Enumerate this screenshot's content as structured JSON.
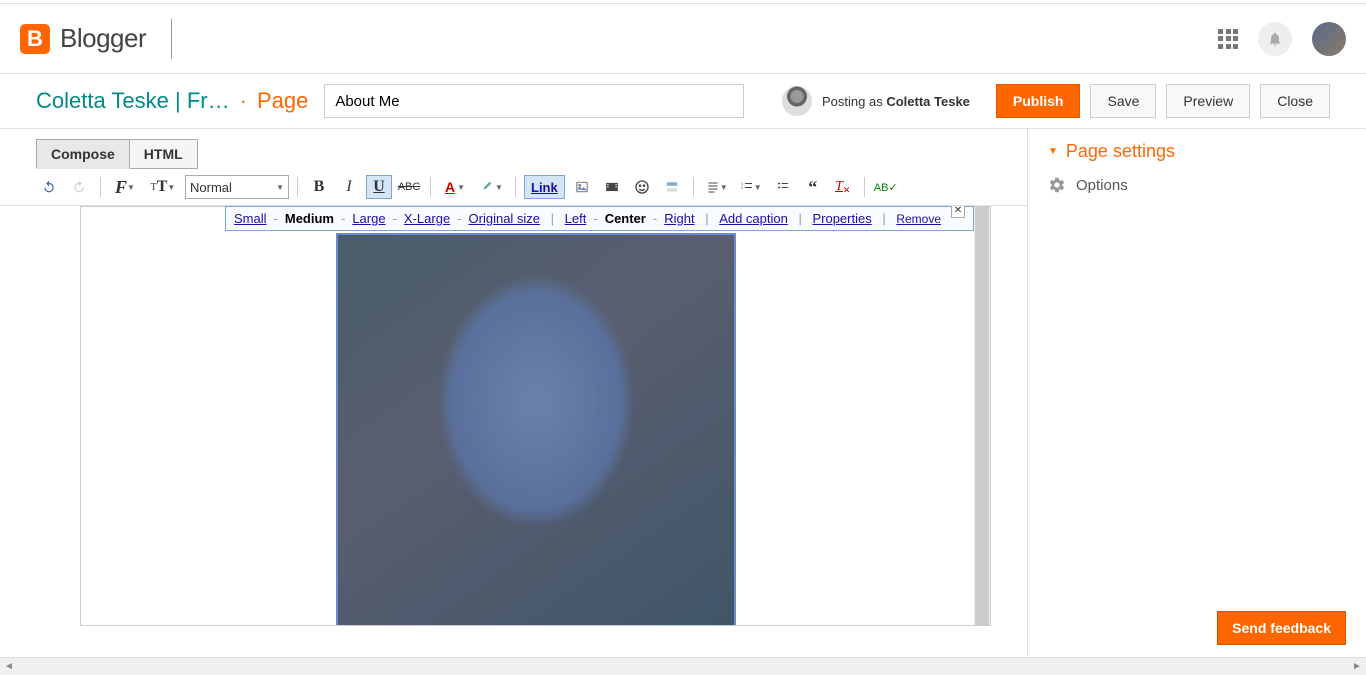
{
  "app": {
    "name": "Blogger"
  },
  "header": {
    "blog_title": "Coletta Teske | Fr…",
    "section": "Page",
    "title_value": "About Me",
    "posting_as_label": "Posting as",
    "posting_as_name": "Coletta Teske",
    "buttons": {
      "publish": "Publish",
      "save": "Save",
      "preview": "Preview",
      "close": "Close"
    }
  },
  "tabs": {
    "compose": "Compose",
    "html": "HTML"
  },
  "toolbar": {
    "format": "Normal",
    "link": "Link"
  },
  "image_toolbar": {
    "sizes": [
      "Small",
      "Medium",
      "Large",
      "X-Large",
      "Original size"
    ],
    "active_size": "Medium",
    "aligns": [
      "Left",
      "Center",
      "Right"
    ],
    "active_align": "Center",
    "add_caption": "Add caption",
    "properties": "Properties",
    "remove": "Remove"
  },
  "sidebar": {
    "settings": "Page settings",
    "options": "Options"
  },
  "feedback": "Send feedback"
}
